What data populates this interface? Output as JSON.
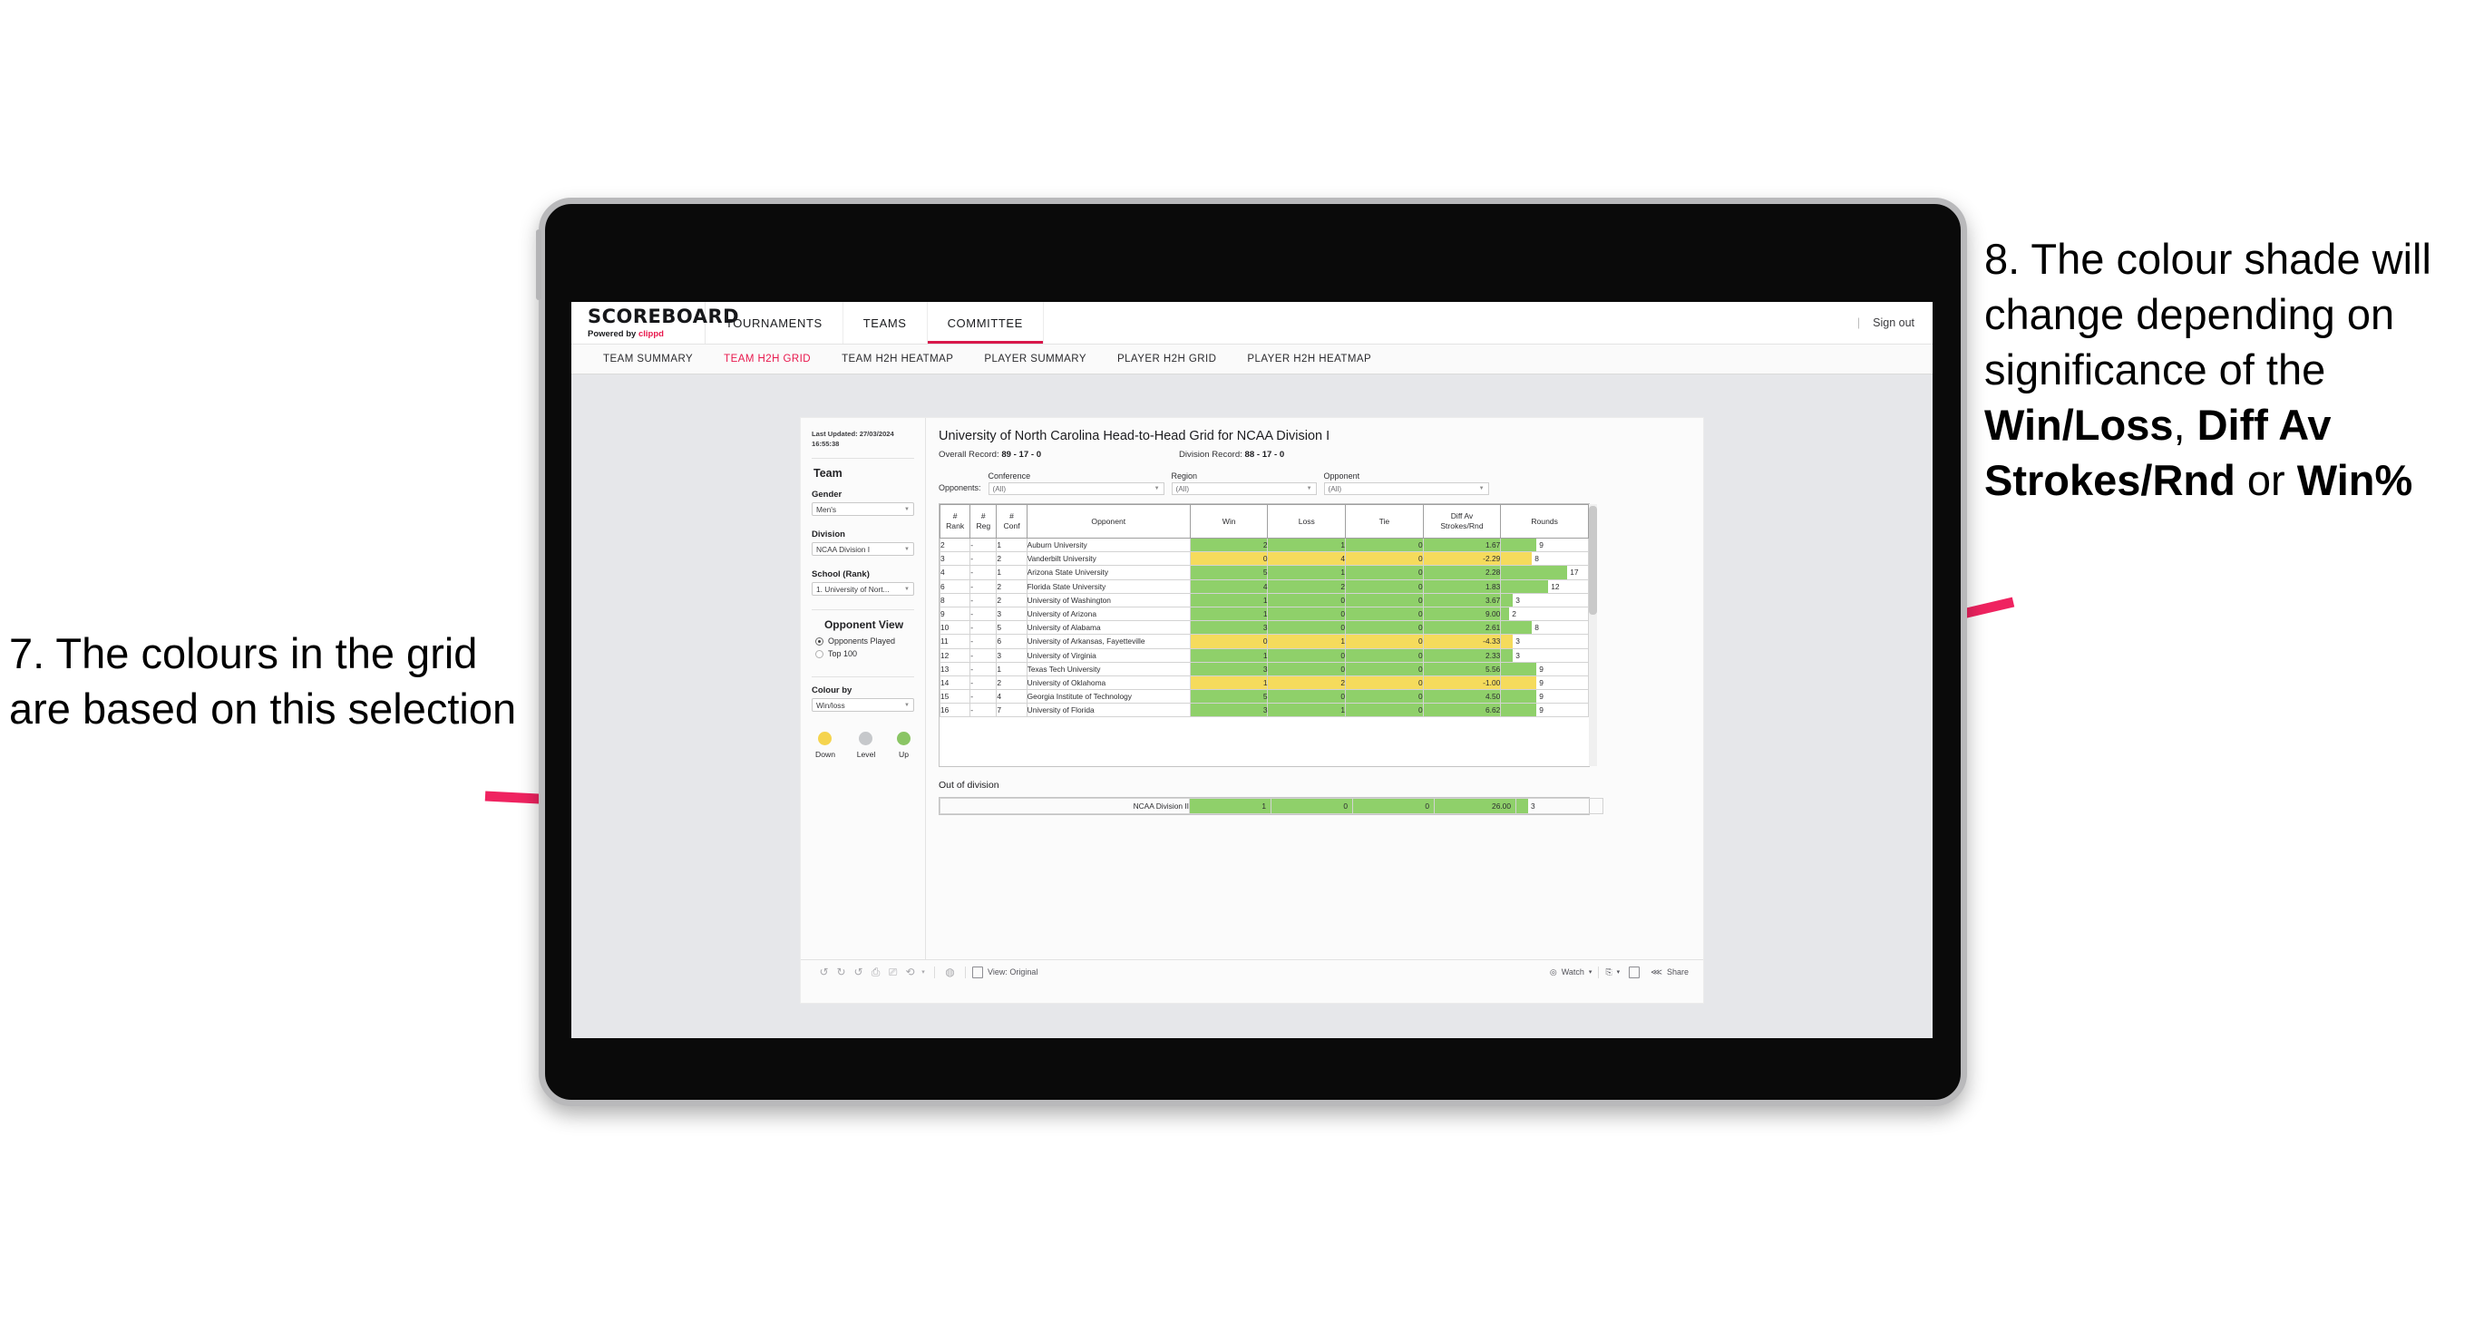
{
  "annotations": {
    "left": "7. The colours in the grid are based on this selection",
    "right_pre": "8. The colour shade will change depending on significance of the ",
    "right_b1": "Win/Loss",
    "right_mid1": ", ",
    "right_b2": "Diff Av Strokes/Rnd",
    "right_mid2": " or ",
    "right_b3": "Win%",
    "accent_color": "#ef2360"
  },
  "app": {
    "logo_word": "SCOREBOARD",
    "logo_sub_pre": "Powered by ",
    "logo_sub_brand": "clippd",
    "top_nav": [
      {
        "label": "TOURNAMENTS",
        "active": false
      },
      {
        "label": "TEAMS",
        "active": false
      },
      {
        "label": "COMMITTEE",
        "active": true
      }
    ],
    "sign_out": "Sign out",
    "divider": "|",
    "sub_nav": [
      {
        "label": "TEAM SUMMARY",
        "active": false
      },
      {
        "label": "TEAM H2H GRID",
        "active": true
      },
      {
        "label": "TEAM H2H HEATMAP",
        "active": false
      },
      {
        "label": "PLAYER SUMMARY",
        "active": false
      },
      {
        "label": "PLAYER H2H GRID",
        "active": false
      },
      {
        "label": "PLAYER H2H HEATMAP",
        "active": false
      }
    ]
  },
  "sidebar": {
    "last_updated": "Last Updated: 27/03/2024 16:55:38",
    "team_heading": "Team",
    "gender_label": "Gender",
    "gender_value": "Men's",
    "division_label": "Division",
    "division_value": "NCAA Division I",
    "school_label": "School (Rank)",
    "school_value": "1. University of Nort...",
    "opponent_view_heading": "Opponent View",
    "radios": [
      {
        "label": "Opponents Played",
        "selected": true
      },
      {
        "label": "Top 100",
        "selected": false
      }
    ],
    "colour_by_label": "Colour by",
    "colour_by_value": "Win/loss",
    "legend": [
      {
        "label": "Down",
        "color": "#f5d44e"
      },
      {
        "label": "Level",
        "color": "#c6c8cb"
      },
      {
        "label": "Up",
        "color": "#8ac564"
      }
    ]
  },
  "main": {
    "title": "University of North Carolina Head-to-Head Grid for NCAA Division I",
    "overall_record_label": "Overall Record: ",
    "overall_record_value": "89 - 17 - 0",
    "division_record_label": "Division Record: ",
    "division_record_value": "88 - 17 - 0",
    "opponents_label": "Opponents:",
    "filters": [
      {
        "label": "Conference",
        "value": "(All)"
      },
      {
        "label": "Region",
        "value": "(All)"
      },
      {
        "label": "Opponent",
        "value": "(All)"
      }
    ],
    "out_of_division_heading": "Out of division"
  },
  "chart_data": {
    "type": "table",
    "title": "University of North Carolina Head-to-Head Grid for NCAA Division I",
    "columns": [
      "# Rank",
      "# Reg",
      "# Conf",
      "Opponent",
      "Win",
      "Loss",
      "Tie",
      "Diff Av Strokes/Rnd",
      "Rounds"
    ],
    "colour_by": "Win/loss",
    "rounds_max": 17,
    "rows": [
      {
        "rank": "2",
        "reg": "-",
        "conf": "1",
        "opponent": "Auburn University",
        "win": "2",
        "loss": "1",
        "tie": "0",
        "diff": "1.67",
        "rounds": "9",
        "rounds_val": 9,
        "state": "up"
      },
      {
        "rank": "3",
        "reg": "-",
        "conf": "2",
        "opponent": "Vanderbilt University",
        "win": "0",
        "loss": "4",
        "tie": "0",
        "diff": "-2.29",
        "rounds": "8",
        "rounds_val": 8,
        "state": "down"
      },
      {
        "rank": "4",
        "reg": "-",
        "conf": "1",
        "opponent": "Arizona State University",
        "win": "5",
        "loss": "1",
        "tie": "0",
        "diff": "2.28",
        "rounds": "17",
        "rounds_val": 17,
        "state": "up"
      },
      {
        "rank": "6",
        "reg": "-",
        "conf": "2",
        "opponent": "Florida State University",
        "win": "4",
        "loss": "2",
        "tie": "0",
        "diff": "1.83",
        "rounds": "12",
        "rounds_val": 12,
        "state": "up"
      },
      {
        "rank": "8",
        "reg": "-",
        "conf": "2",
        "opponent": "University of Washington",
        "win": "1",
        "loss": "0",
        "tie": "0",
        "diff": "3.67",
        "rounds": "3",
        "rounds_val": 3,
        "state": "up"
      },
      {
        "rank": "9",
        "reg": "-",
        "conf": "3",
        "opponent": "University of Arizona",
        "win": "1",
        "loss": "0",
        "tie": "0",
        "diff": "9.00",
        "rounds": "2",
        "rounds_val": 2,
        "state": "up"
      },
      {
        "rank": "10",
        "reg": "-",
        "conf": "5",
        "opponent": "University of Alabama",
        "win": "3",
        "loss": "0",
        "tie": "0",
        "diff": "2.61",
        "rounds": "8",
        "rounds_val": 8,
        "state": "up"
      },
      {
        "rank": "11",
        "reg": "-",
        "conf": "6",
        "opponent": "University of Arkansas, Fayetteville",
        "win": "0",
        "loss": "1",
        "tie": "0",
        "diff": "-4.33",
        "rounds": "3",
        "rounds_val": 3,
        "state": "down"
      },
      {
        "rank": "12",
        "reg": "-",
        "conf": "3",
        "opponent": "University of Virginia",
        "win": "1",
        "loss": "0",
        "tie": "0",
        "diff": "2.33",
        "rounds": "3",
        "rounds_val": 3,
        "state": "up"
      },
      {
        "rank": "13",
        "reg": "-",
        "conf": "1",
        "opponent": "Texas Tech University",
        "win": "3",
        "loss": "0",
        "tie": "0",
        "diff": "5.56",
        "rounds": "9",
        "rounds_val": 9,
        "state": "up"
      },
      {
        "rank": "14",
        "reg": "-",
        "conf": "2",
        "opponent": "University of Oklahoma",
        "win": "1",
        "loss": "2",
        "tie": "0",
        "diff": "-1.00",
        "rounds": "9",
        "rounds_val": 9,
        "state": "down"
      },
      {
        "rank": "15",
        "reg": "-",
        "conf": "4",
        "opponent": "Georgia Institute of Technology",
        "win": "5",
        "loss": "0",
        "tie": "0",
        "diff": "4.50",
        "rounds": "9",
        "rounds_val": 9,
        "state": "up"
      },
      {
        "rank": "16",
        "reg": "-",
        "conf": "7",
        "opponent": "University of Florida",
        "win": "3",
        "loss": "1",
        "tie": "0",
        "diff": "6.62",
        "rounds": "9",
        "rounds_val": 9,
        "state": "up"
      }
    ],
    "out_of_division": [
      {
        "opponent": "NCAA Division II",
        "win": "1",
        "loss": "0",
        "tie": "0",
        "diff": "26.00",
        "rounds": "3",
        "rounds_val": 3,
        "state": "up"
      }
    ]
  },
  "toolbar": {
    "view_label": "View: Original",
    "watch_label": "Watch",
    "share_label": "Share",
    "caret": "▾"
  }
}
